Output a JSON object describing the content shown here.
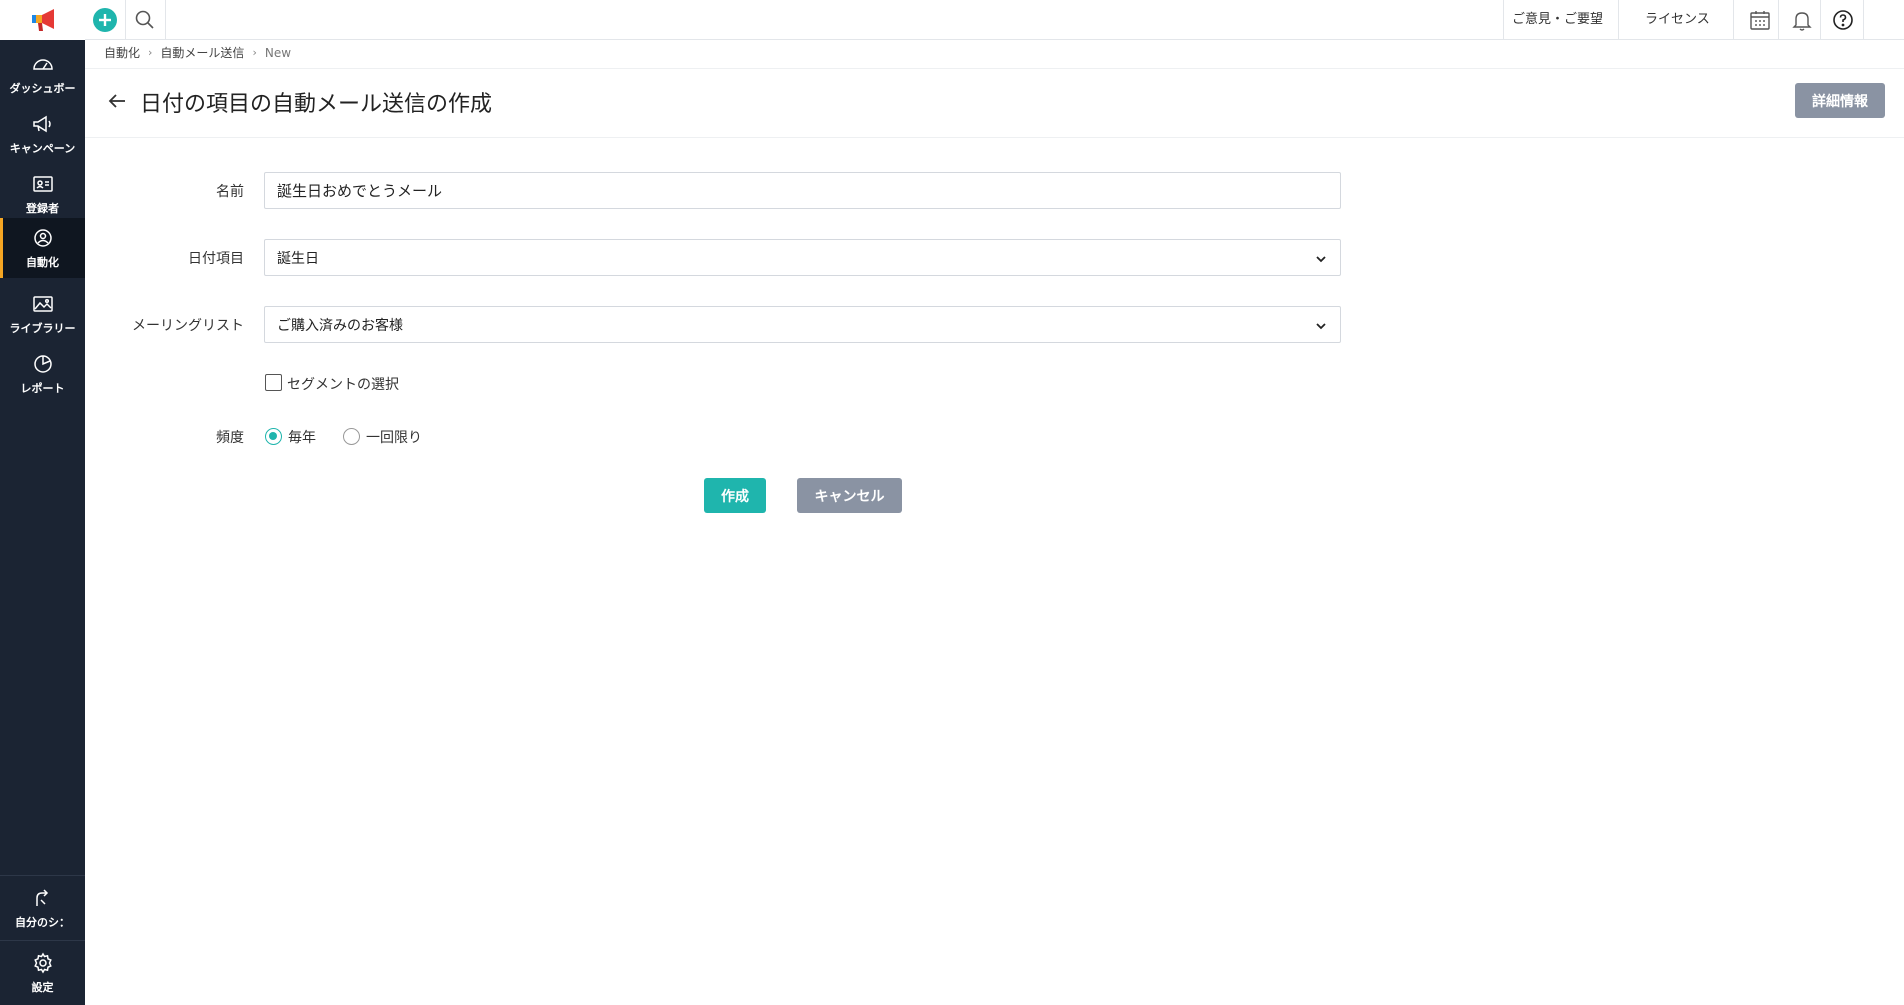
{
  "sidebar": {
    "items": [
      {
        "label": "ダッシュボー",
        "icon": "dashboard-icon"
      },
      {
        "label": "キャンペーン",
        "icon": "megaphone-icon"
      },
      {
        "label": "登録者",
        "icon": "contact-card-icon"
      },
      {
        "label": "自動化",
        "icon": "automation-icon",
        "active": true
      },
      {
        "label": "ライブラリー",
        "icon": "image-icon"
      },
      {
        "label": "レポート",
        "icon": "pie-chart-icon"
      }
    ],
    "bottom": [
      {
        "label": "自分のシ：",
        "icon": "share-icon"
      },
      {
        "label": "設定",
        "icon": "gear-icon"
      }
    ]
  },
  "topbar": {
    "feedback": "ご意見・ご要望",
    "license": "ライセンス"
  },
  "breadcrumb": {
    "items": [
      "自動化",
      "自動メール送信",
      "New"
    ]
  },
  "page": {
    "title": "日付の項目の自動メール送信の作成",
    "detail_button": "詳細情報"
  },
  "form": {
    "name_label": "名前",
    "name_value": "誕生日おめでとうメール",
    "date_field_label": "日付項目",
    "date_field_value": "誕生日",
    "mailing_list_label": "メーリングリスト",
    "mailing_list_value": "ご購入済みのお客様",
    "segment_label": "セグメントの選択",
    "segment_checked": false,
    "frequency_label": "頻度",
    "frequency_options": [
      "毎年",
      "一回限り"
    ],
    "frequency_selected": "毎年",
    "create_button": "作成",
    "cancel_button": "キャンセル"
  },
  "colors": {
    "sidebar_bg": "#1b2433",
    "accent": "#1fb5ad",
    "active_marker": "#f5a623",
    "secondary_button": "#8a93a3"
  }
}
